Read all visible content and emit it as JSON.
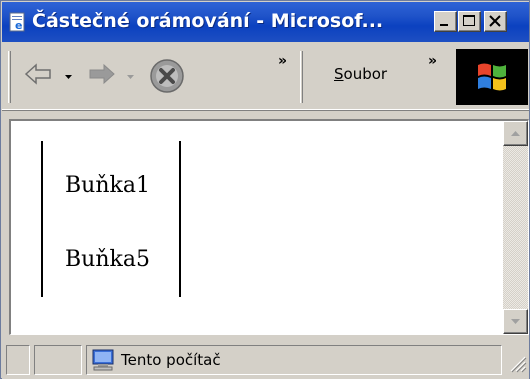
{
  "window": {
    "title": "Částečné orámování - Microsof..."
  },
  "toolbar": {
    "back_icon": "back-arrow-icon",
    "forward_icon": "forward-arrow-icon",
    "stop_icon": "stop-icon",
    "chevron_1": "»",
    "menu_label_prefix": "S",
    "menu_label_rest": "oubor",
    "chevron_2": "»"
  },
  "content": {
    "cells": [
      "Buňka1",
      "Buňka5"
    ]
  },
  "statusbar": {
    "zone_text": "Tento počítač",
    "zone_icon": "computer-icon"
  },
  "colors": {
    "titlebar": "#0b41c0",
    "chrome": "#d4d0c8",
    "stop_red": "#d93a2b"
  }
}
